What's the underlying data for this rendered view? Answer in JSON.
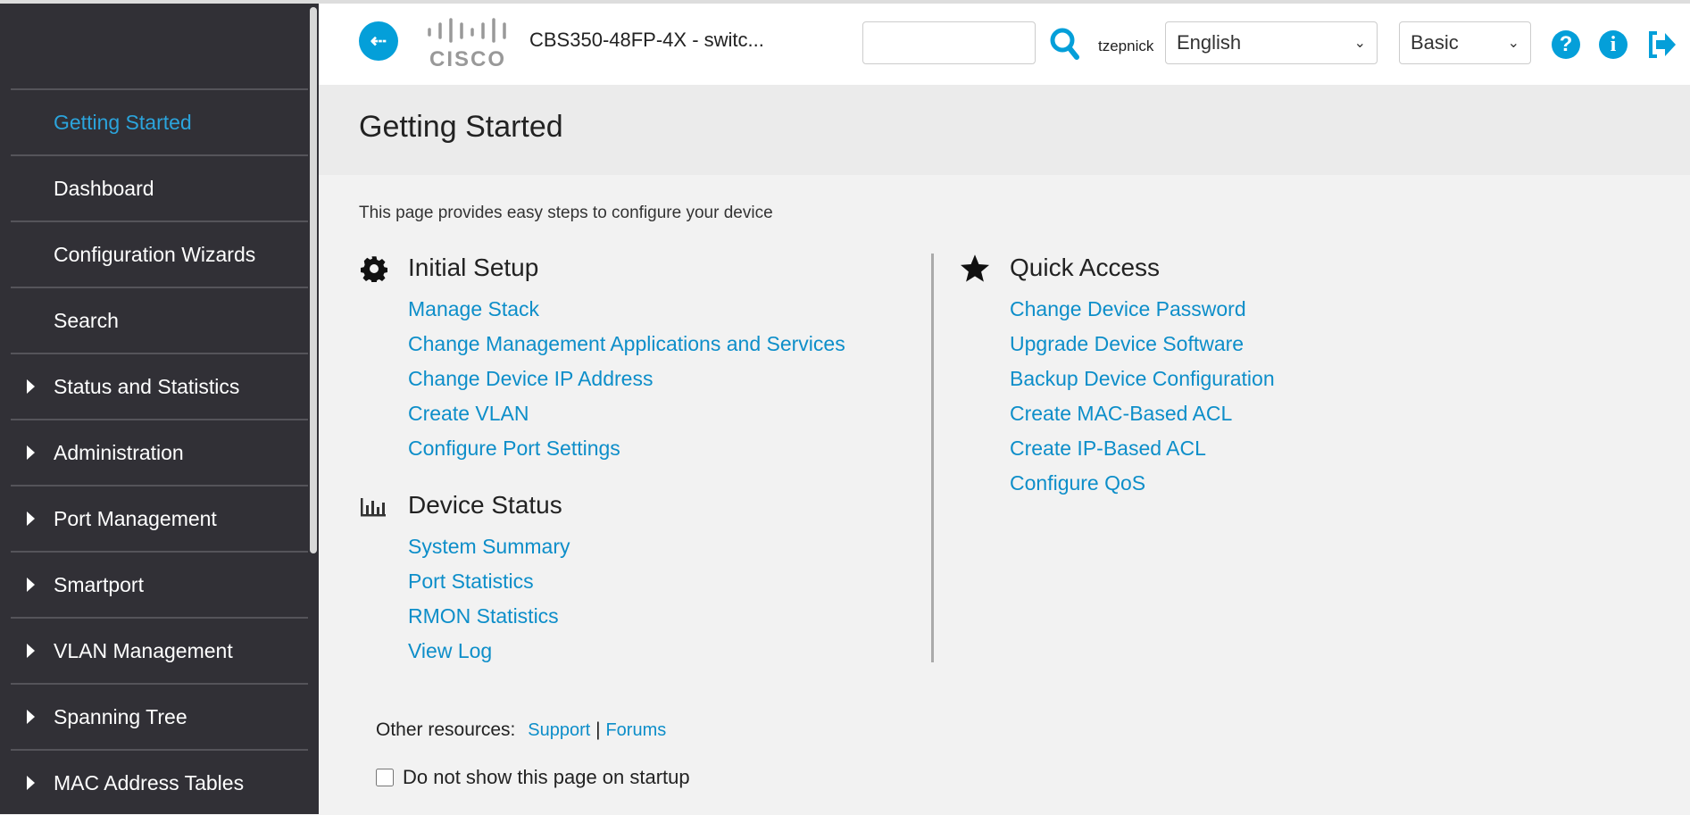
{
  "header": {
    "device_title": "CBS350-48FP-4X - switc...",
    "logo_text": "CISCO",
    "search_value": "",
    "username": "tzepnick",
    "language": "English",
    "mode": "Basic"
  },
  "sidebar": {
    "items": [
      {
        "label": "Getting Started",
        "active": true,
        "expandable": false
      },
      {
        "label": "Dashboard",
        "expandable": false
      },
      {
        "label": "Configuration Wizards",
        "expandable": false
      },
      {
        "label": "Search",
        "expandable": false
      },
      {
        "label": "Status and Statistics",
        "expandable": true
      },
      {
        "label": "Administration",
        "expandable": true
      },
      {
        "label": "Port Management",
        "expandable": true
      },
      {
        "label": "Smartport",
        "expandable": true
      },
      {
        "label": "VLAN Management",
        "expandable": true
      },
      {
        "label": "Spanning Tree",
        "expandable": true
      },
      {
        "label": "MAC Address Tables",
        "expandable": true
      }
    ]
  },
  "page": {
    "title": "Getting Started",
    "description": "This page provides easy steps to configure your device",
    "initial_setup": {
      "heading": "Initial Setup",
      "links": [
        "Manage Stack",
        "Change Management Applications and Services",
        "Change Device IP Address",
        "Create VLAN",
        "Configure Port Settings"
      ]
    },
    "device_status": {
      "heading": "Device Status",
      "links": [
        "System Summary",
        "Port Statistics",
        "RMON Statistics",
        "View Log"
      ]
    },
    "quick_access": {
      "heading": "Quick Access",
      "links": [
        "Change Device Password",
        "Upgrade Device Software",
        "Backup Device Configuration",
        "Create MAC-Based ACL",
        "Create IP-Based ACL",
        "Configure QoS"
      ]
    },
    "other_resources_label": "Other resources:",
    "support_link": "Support",
    "separator": "|",
    "forums_link": "Forums",
    "startup_checkbox_label": "Do not show this page on startup",
    "startup_checked": false
  },
  "colors": {
    "accent": "#049fd9",
    "link": "#0d8ec9",
    "sidebar": "#313036"
  }
}
